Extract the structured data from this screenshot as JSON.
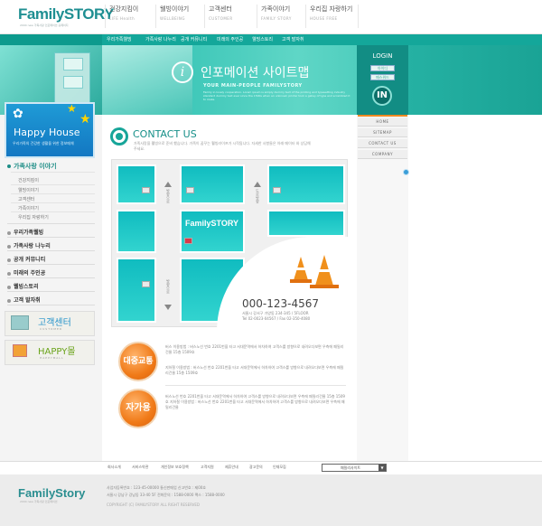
{
  "brand": {
    "logo": "FamilySTORY",
    "tagline": "2004 new 가족사랑 인포메이션 홈페이지"
  },
  "gnav": [
    {
      "ko": "건강지킴이",
      "en": "LIFE Health"
    },
    {
      "ko": "웰빙이야기",
      "en": "WELLBEING"
    },
    {
      "ko": "고객센터",
      "en": "CUSTOMER"
    },
    {
      "ko": "가족이야기",
      "en": "FAMILY STORY"
    },
    {
      "ko": "우리집 자랑하기",
      "en": "HOUSE FREE"
    }
  ],
  "subnav": [
    "우리가족웰빙",
    "가족사랑 나누리",
    "공개 커뮤니티",
    "미래의 주인공",
    "웰빙스토리",
    "고객 발자취"
  ],
  "banner": {
    "title": "인포메이션 사이트맵",
    "subtitle": "YOUR MAIN-PEOPLE FAMILYSTORY",
    "desc": "Family in lovely cooperation. Lorem ipsum is simply dummy text of the printing and typesetting industry standard dummy text ever since the 1500s when an unknown printer took a galley of type and scrambled it to make."
  },
  "login": {
    "title": "LOGIN",
    "id_label": "아이디",
    "pw_label": "패스워드",
    "button": "IN"
  },
  "left": {
    "happy_title": "Happy House",
    "happy_sub": "우리가족의 건강한 생활을 위한 정보매체",
    "section_title": "가족사랑 이야기",
    "sub_items": [
      "건강지킴이",
      "웰빙이야기",
      "고객센터",
      "가족이야기",
      "우리집 자랑하기"
    ],
    "menu": [
      "우리가족웰빙",
      "가족사랑 나누리",
      "공개 커뮤니티",
      "미래의 주인공",
      "웰빙스토리",
      "고객 발자취"
    ],
    "promo1": {
      "title": "고객센터",
      "sub": "CUSTOMER"
    },
    "promo2": {
      "title": "HAPPY몰",
      "sub": "HAPPYMALL"
    }
  },
  "contact": {
    "title": "CONTACT US",
    "desc": "가족사랑을 웰빙으로 준비 했습니다. 가족이 꿈꾸는 웰빙라이프가 시작됩니다. 자세한 사항들은 아래 메이터 와 상담해주세요."
  },
  "map": {
    "brand": "FamilySTORY",
    "road1": "방향으로",
    "road2": "도로방향",
    "road3": "방향으로",
    "phone": "000-123-4567",
    "address": "서울시 강서구 가양동 234-345 / 5FLOOR",
    "tel": "Tel 02-0023-04567 / Fax 02-350-4080"
  },
  "transit": {
    "bus_label": "대중교통",
    "car_label": "자가용",
    "bus_lines": [
      "버스 이용방법 : 버스노선 번호 2201번을 타고 서대문역에서 하차하여 고객스를 방향으로 내려오다보면 우측에 패밀리건물 15층 1509호",
      "지하철 이용방법 : 버스노선 번호 2201번을 타고 서대문역에서 하차하여 고객스를 방향으로 내려오다보면 우측에 패밀리건물 15층 1509호"
    ],
    "car_lines": [
      "버스노선 번호 2201번을 타고 서대문역에서 하차하여 고객스를 방향으로 내려오다보면 우측에 패밀리건물 15층 1509호 지하철 이용방법 : 버스노선 번호 2201번을 타고 서대문역에서 하차하여 고객스를 방향으로 내려오다보면 우측에 패밀리건물"
    ]
  },
  "quick": [
    "HOME",
    "SITEMAP",
    "CONTACT US",
    "COMPANY"
  ],
  "footer": {
    "links": [
      "회사소개",
      "서비스약관",
      "개인정보 보호정책",
      "고객지원",
      "제휴안내",
      "광고문의",
      "인재모집"
    ],
    "select": "패밀리사이트",
    "logo": "FamilyStory",
    "tag": "2004 new 가족사랑 인포메이션",
    "line1": "사업자등록번호 : 123-45-00000  통신판매업 신고번호 : 제00호",
    "line2": "서울시 강남구 강남동 33-40 5F  전화문의 : 1588-0000 팩스 : 1588-0000",
    "line3": "COPYRIGHT (C) FAMILYSTORY ALL RIGHT RESERVED"
  }
}
